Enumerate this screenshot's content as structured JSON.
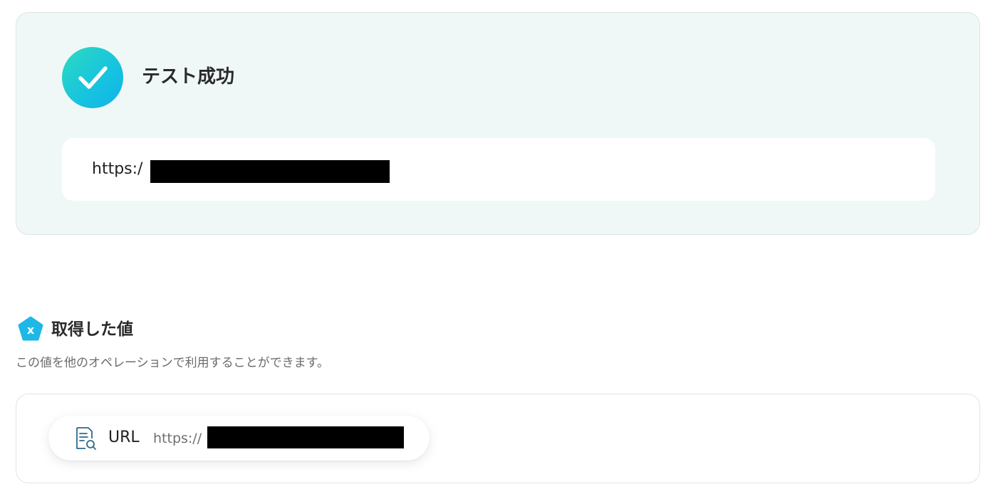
{
  "result": {
    "status_title": "テスト成功",
    "status_icon": "check-icon",
    "output_url": "https:/",
    "accent_gradient": [
      "#2edac0",
      "#10b3e8"
    ]
  },
  "obtained_values": {
    "title": "取得した値",
    "section_icon": "variable-x-icon",
    "description": "この値を他のオペレーションで利用することができます。",
    "items": [
      {
        "icon": "document-search-icon",
        "label": "URL",
        "value": "https://"
      }
    ]
  }
}
